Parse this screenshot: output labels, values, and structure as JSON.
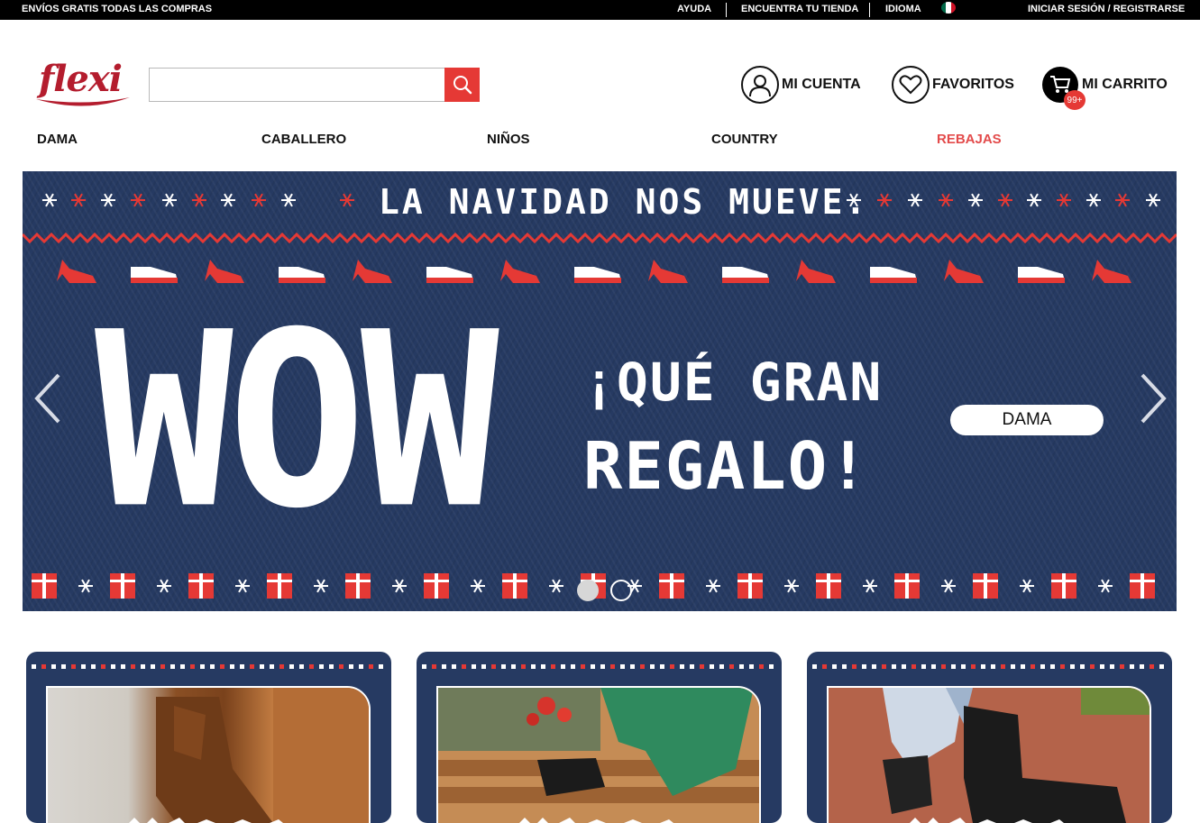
{
  "topbar": {
    "promo": "ENVÍOS GRATIS TODAS LAS COMPRAS",
    "help": "AYUDA",
    "store_finder": "ENCUENTRA TU TIENDA",
    "language": "IDIOMA",
    "login": "INICIAR SESIÓN / REGISTRARSE"
  },
  "brand": {
    "logo_text": "flexi",
    "registered": "®",
    "color": "#b41d2e"
  },
  "search": {
    "placeholder": "",
    "button_icon": "search-icon",
    "button_color": "#e53935"
  },
  "header_actions": {
    "account": "MI CUENTA",
    "favorites": "FAVORITOS",
    "cart": "MI CARRITO",
    "cart_count": "99+"
  },
  "nav": [
    {
      "label": "DAMA"
    },
    {
      "label": "CABALLERO"
    },
    {
      "label": "NIÑOS"
    },
    {
      "label": "COUNTRY"
    },
    {
      "label": "REBAJAS",
      "color": "#e34b4b"
    }
  ],
  "hero": {
    "headline": "LA NAVIDAD NOS MUEVE.",
    "big_word": "WOW",
    "line1": "¡QUÉ GRAN",
    "line2": "REGALO!",
    "cta": "DAMA",
    "background": "#263a62",
    "accent_red": "#e53935",
    "slides_total": 2,
    "active_slide": 1
  }
}
